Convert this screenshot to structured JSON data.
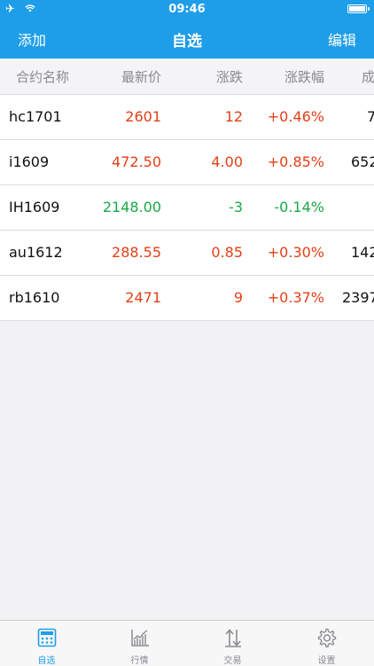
{
  "status": {
    "time": "09:46"
  },
  "nav": {
    "left": "添加",
    "title": "自选",
    "right": "编辑"
  },
  "columns": {
    "name": "合约名称",
    "price": "最新价",
    "change": "涨跌",
    "pct": "涨跌幅",
    "extra": "成"
  },
  "rows": [
    {
      "name": "hc1701",
      "price": "2601",
      "change": "12",
      "pct": "+0.46%",
      "vol": "7",
      "trend": "up"
    },
    {
      "name": "i1609",
      "price": "472.50",
      "change": "4.00",
      "pct": "+0.85%",
      "vol": "652",
      "trend": "up"
    },
    {
      "name": "IH1609",
      "price": "2148.00",
      "change": "-3",
      "pct": "-0.14%",
      "vol": "",
      "trend": "down"
    },
    {
      "name": "au1612",
      "price": "288.55",
      "change": "0.85",
      "pct": "+0.30%",
      "vol": "142",
      "trend": "up"
    },
    {
      "name": "rb1610",
      "price": "2471",
      "change": "9",
      "pct": "+0.37%",
      "vol": "2397",
      "trend": "up"
    }
  ],
  "tabs": [
    {
      "label": "自选",
      "icon": "calculator-grid-icon",
      "active": true
    },
    {
      "label": "行情",
      "icon": "chart-icon",
      "active": false
    },
    {
      "label": "交易",
      "icon": "sort-arrows-icon",
      "active": false
    },
    {
      "label": "设置",
      "icon": "gear-icon",
      "active": false
    }
  ],
  "colors": {
    "accent": "#1e9de8",
    "up": "#e23f16",
    "down": "#1aa845"
  }
}
